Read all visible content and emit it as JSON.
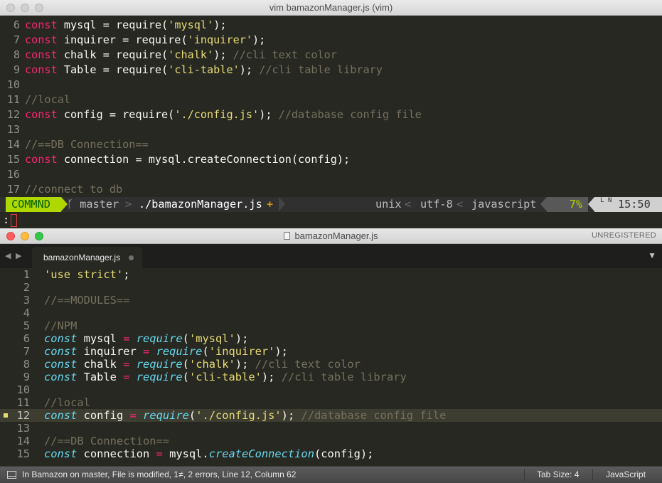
{
  "vim": {
    "title": "vim bamazonManager.js (vim)",
    "lines": [
      {
        "num": "6",
        "tokens": [
          {
            "c": "t-kw",
            "t": "const"
          },
          {
            "c": "t-plain",
            "t": " mysql = require("
          },
          {
            "c": "t-str",
            "t": "'mysql'"
          },
          {
            "c": "t-plain",
            "t": ");"
          }
        ]
      },
      {
        "num": "7",
        "tokens": [
          {
            "c": "t-kw",
            "t": "const"
          },
          {
            "c": "t-plain",
            "t": " inquirer = require("
          },
          {
            "c": "t-str",
            "t": "'inquirer'"
          },
          {
            "c": "t-plain",
            "t": ");"
          }
        ]
      },
      {
        "num": "8",
        "tokens": [
          {
            "c": "t-kw",
            "t": "const"
          },
          {
            "c": "t-plain",
            "t": " chalk = require("
          },
          {
            "c": "t-str",
            "t": "'chalk'"
          },
          {
            "c": "t-plain",
            "t": "); "
          },
          {
            "c": "t-com",
            "t": "//cli text color"
          }
        ]
      },
      {
        "num": "9",
        "tokens": [
          {
            "c": "t-kw",
            "t": "const"
          },
          {
            "c": "t-plain",
            "t": " Table = require("
          },
          {
            "c": "t-str",
            "t": "'cli-table'"
          },
          {
            "c": "t-plain",
            "t": "); "
          },
          {
            "c": "t-com",
            "t": "//cli table library"
          }
        ]
      },
      {
        "num": "10",
        "tokens": []
      },
      {
        "num": "11",
        "tokens": [
          {
            "c": "t-com",
            "t": "//local"
          }
        ]
      },
      {
        "num": "12",
        "tokens": [
          {
            "c": "t-kw",
            "t": "const"
          },
          {
            "c": "t-plain",
            "t": " config = require("
          },
          {
            "c": "t-str",
            "t": "'./config.js'"
          },
          {
            "c": "t-plain",
            "t": "); "
          },
          {
            "c": "t-com",
            "t": "//database config file"
          }
        ]
      },
      {
        "num": "13",
        "tokens": []
      },
      {
        "num": "14",
        "tokens": [
          {
            "c": "t-com",
            "t": "//==DB Connection=="
          }
        ]
      },
      {
        "num": "15",
        "tokens": [
          {
            "c": "t-kw",
            "t": "const"
          },
          {
            "c": "t-plain",
            "t": " connection = mysql.createConnection(config);"
          }
        ]
      },
      {
        "num": "16",
        "tokens": []
      },
      {
        "num": "17",
        "tokens": [
          {
            "c": "t-com",
            "t": "//connect to db"
          }
        ]
      }
    ],
    "status": {
      "mode": "COMMND",
      "branch_icon": "ᚴ",
      "branch": "master",
      "filename": "./bamazonManager.js",
      "modified": "+",
      "fileformat": "unix",
      "encoding": "utf-8",
      "filetype": "javascript",
      "percent": "7%",
      "ln_label": "L N",
      "position": "15:50",
      "separator": "<"
    },
    "cmdline": ":"
  },
  "sublime": {
    "title": "bamazonManager.js",
    "unregistered": "UNREGISTERED",
    "tab_label": "bamazonManager.js",
    "lines": [
      {
        "num": "1",
        "tokens": [
          {
            "c": "t-str",
            "t": "'use strict'"
          },
          {
            "c": "t-plain",
            "t": ";"
          }
        ]
      },
      {
        "num": "2",
        "tokens": []
      },
      {
        "num": "3",
        "tokens": [
          {
            "c": "t-com",
            "t": "//==MODULES=="
          }
        ]
      },
      {
        "num": "4",
        "tokens": []
      },
      {
        "num": "5",
        "tokens": [
          {
            "c": "t-com",
            "t": "//NPM"
          }
        ]
      },
      {
        "num": "6",
        "tokens": [
          {
            "c": "t-kwi",
            "t": "const"
          },
          {
            "c": "t-plain",
            "t": " mysql "
          },
          {
            "c": "t-op",
            "t": "="
          },
          {
            "c": "t-plain",
            "t": " "
          },
          {
            "c": "t-kwi",
            "t": "require"
          },
          {
            "c": "t-plain",
            "t": "("
          },
          {
            "c": "t-str",
            "t": "'mysql'"
          },
          {
            "c": "t-plain",
            "t": ");"
          }
        ]
      },
      {
        "num": "7",
        "tokens": [
          {
            "c": "t-kwi",
            "t": "const"
          },
          {
            "c": "t-plain",
            "t": " inquirer "
          },
          {
            "c": "t-op",
            "t": "="
          },
          {
            "c": "t-plain",
            "t": " "
          },
          {
            "c": "t-kwi",
            "t": "require"
          },
          {
            "c": "t-plain",
            "t": "("
          },
          {
            "c": "t-str",
            "t": "'inquirer'"
          },
          {
            "c": "t-plain",
            "t": ");"
          }
        ]
      },
      {
        "num": "8",
        "tokens": [
          {
            "c": "t-kwi",
            "t": "const"
          },
          {
            "c": "t-plain",
            "t": " chalk "
          },
          {
            "c": "t-op",
            "t": "="
          },
          {
            "c": "t-plain",
            "t": " "
          },
          {
            "c": "t-kwi",
            "t": "require"
          },
          {
            "c": "t-plain",
            "t": "("
          },
          {
            "c": "t-str",
            "t": "'chalk'"
          },
          {
            "c": "t-plain",
            "t": "); "
          },
          {
            "c": "t-com",
            "t": "//cli text color"
          }
        ]
      },
      {
        "num": "9",
        "tokens": [
          {
            "c": "t-kwi",
            "t": "const"
          },
          {
            "c": "t-plain",
            "t": " Table "
          },
          {
            "c": "t-op",
            "t": "="
          },
          {
            "c": "t-plain",
            "t": " "
          },
          {
            "c": "t-kwi",
            "t": "require"
          },
          {
            "c": "t-plain",
            "t": "("
          },
          {
            "c": "t-str",
            "t": "'cli-table'"
          },
          {
            "c": "t-plain",
            "t": "); "
          },
          {
            "c": "t-com",
            "t": "//cli table library"
          }
        ]
      },
      {
        "num": "10",
        "tokens": []
      },
      {
        "num": "11",
        "tokens": [
          {
            "c": "t-com",
            "t": "//local"
          }
        ]
      },
      {
        "num": "12",
        "active": true,
        "tokens": [
          {
            "c": "t-kwi",
            "t": "const"
          },
          {
            "c": "t-plain",
            "t": " config "
          },
          {
            "c": "t-op",
            "t": "="
          },
          {
            "c": "t-plain",
            "t": " "
          },
          {
            "c": "t-kwi",
            "t": "require"
          },
          {
            "c": "t-plain",
            "t": "("
          },
          {
            "c": "t-str",
            "t": "'./config.js'"
          },
          {
            "c": "t-plain",
            "t": "); "
          },
          {
            "c": "t-com",
            "t": "//database config file"
          }
        ]
      },
      {
        "num": "13",
        "tokens": []
      },
      {
        "num": "14",
        "tokens": [
          {
            "c": "t-com",
            "t": "//==DB Connection=="
          }
        ]
      },
      {
        "num": "15",
        "tokens": [
          {
            "c": "t-kwi",
            "t": "const"
          },
          {
            "c": "t-plain",
            "t": " connection "
          },
          {
            "c": "t-op",
            "t": "="
          },
          {
            "c": "t-plain",
            "t": " mysql."
          },
          {
            "c": "t-kwi",
            "t": "createConnection"
          },
          {
            "c": "t-plain",
            "t": "(config);"
          }
        ]
      }
    ],
    "status": {
      "message": "In Bamazon on master, File is modified, 1≠, 2 errors, Line 12, Column 62",
      "tab_size": "Tab Size: 4",
      "syntax": "JavaScript"
    }
  },
  "colors": {
    "background": "#272822",
    "keyword": "#f92672",
    "string": "#e6db74",
    "comment": "#75715e",
    "storage": "#66d9ef",
    "mode_bg": "#afd700"
  }
}
